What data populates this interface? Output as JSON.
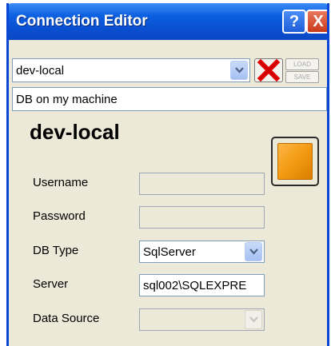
{
  "window": {
    "title": "Connection Editor"
  },
  "title_buttons": {
    "help": "?",
    "close": "X"
  },
  "connection": {
    "selected": "dev-local",
    "description": "DB on my machine",
    "load_label": "LOAD",
    "save_label": "SAVE"
  },
  "form": {
    "heading": "dev-local",
    "username_label": "Username",
    "username_value": "",
    "password_label": "Password",
    "password_value": "",
    "dbtype_label": "DB Type",
    "dbtype_value": "SqlServer",
    "server_label": "Server",
    "server_value": "sql002\\SQLEXPRE",
    "datasource_label": "Data Source",
    "datasource_value": ""
  },
  "colors": {
    "titlebar": "#0a4fd1",
    "accent_button": "#f39a12",
    "delete_x": "#e00000"
  }
}
